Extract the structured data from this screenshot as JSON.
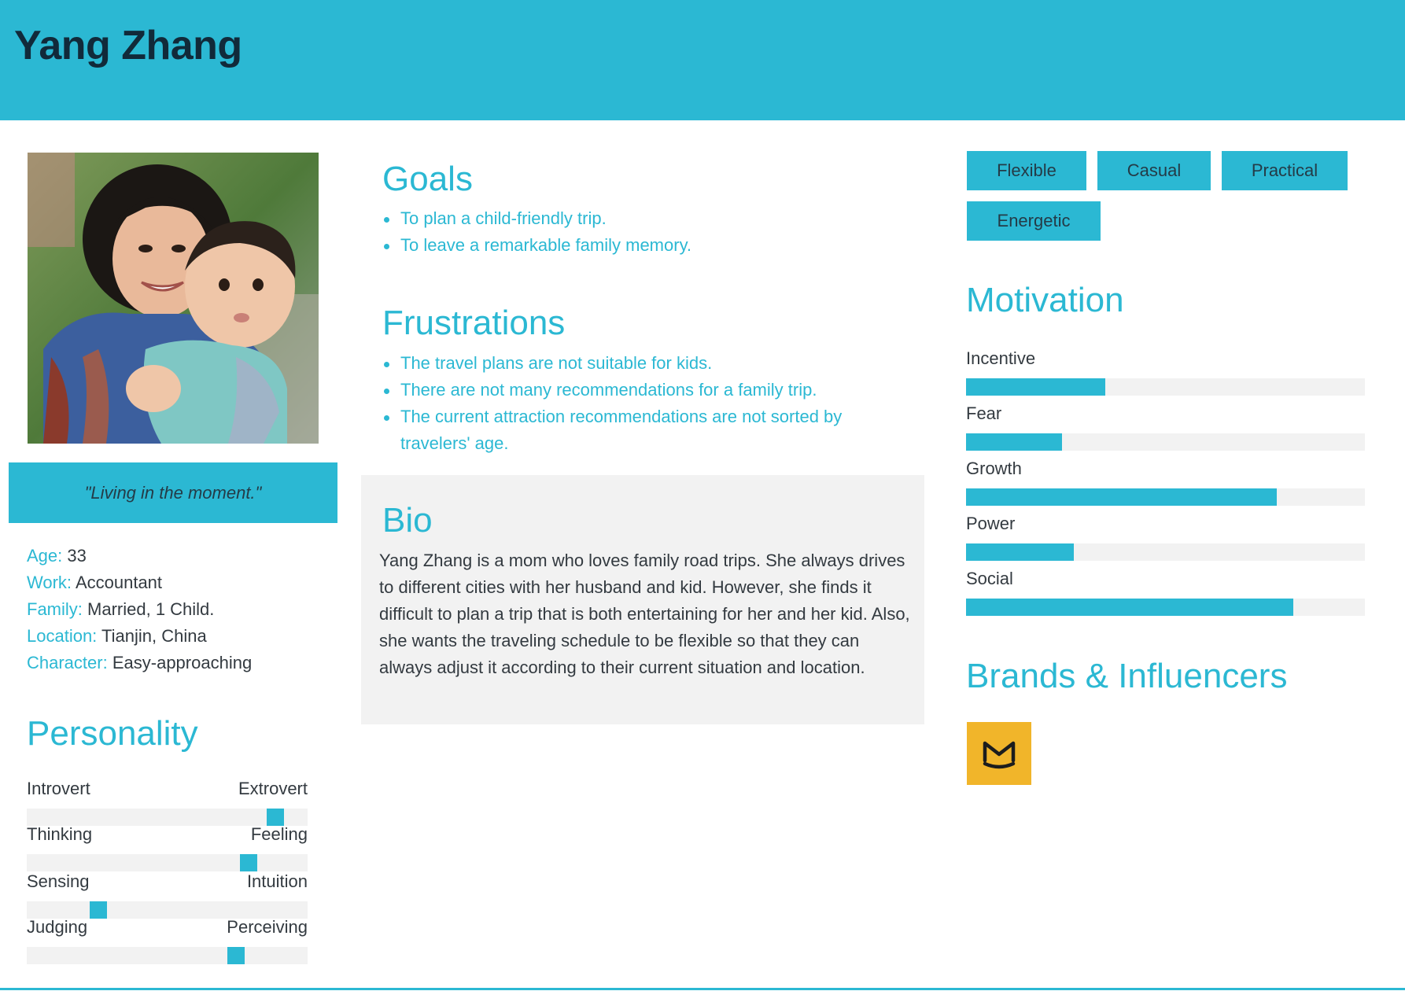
{
  "persona": {
    "name": "Yang Zhang"
  },
  "quote": "\"Living in the moment.\"",
  "facts": [
    {
      "label": "Age:",
      "value": "33"
    },
    {
      "label": "Work:",
      "value": "Accountant"
    },
    {
      "label": "Family:",
      "value": "Married, 1 Child."
    },
    {
      "label": "Location:",
      "value": "Tianjin, China"
    },
    {
      "label": "Character:",
      "value": "Easy-approaching"
    }
  ],
  "personality": {
    "title": "Personality",
    "scales": [
      {
        "left": "Introvert",
        "right": "Extrovert",
        "level": 0.91
      },
      {
        "left": "Thinking",
        "right": "Feeling",
        "level": 0.81
      },
      {
        "left": "Sensing",
        "right": "Intuition",
        "level": 0.24
      },
      {
        "left": "Judging",
        "right": "Perceiving",
        "level": 0.76
      }
    ]
  },
  "goals": {
    "title": "Goals",
    "items": [
      "To plan a child-friendly trip.",
      "To leave a remarkable family memory."
    ]
  },
  "frustrations": {
    "title": "Frustrations",
    "items": [
      "The travel plans are not suitable for kids.",
      "There are not many recommendations for a family trip.",
      "The current attraction recommendations are not sorted by travelers' age."
    ]
  },
  "bio": {
    "title": "Bio",
    "text": "Yang Zhang is a mom who loves family road trips. She always drives to different cities with her husband and kid. However, she finds it difficult to plan a trip that is both entertaining for her and her kid. Also, she wants the traveling schedule to be flexible so that they can always adjust it according to their current situation and location."
  },
  "tags": [
    "Flexible",
    "Casual",
    "Practical",
    "Energetic"
  ],
  "motivation": {
    "title": "Motivation",
    "items": [
      {
        "name": "Incentive",
        "level": 0.35
      },
      {
        "name": "Fear",
        "level": 0.24
      },
      {
        "name": "Growth",
        "level": 0.78
      },
      {
        "name": "Power",
        "level": 0.27
      },
      {
        "name": "Social",
        "level": 0.82
      }
    ]
  },
  "brands": {
    "title": "Brands & Influencers",
    "logos": [
      {
        "icon": "mafengwo-logo-icon",
        "color": "#f1b52a"
      }
    ]
  },
  "colors": {
    "accent": "#2bb8d3",
    "dark": "#112a3a",
    "track": "#f2f2f2",
    "text": "#333a40"
  }
}
